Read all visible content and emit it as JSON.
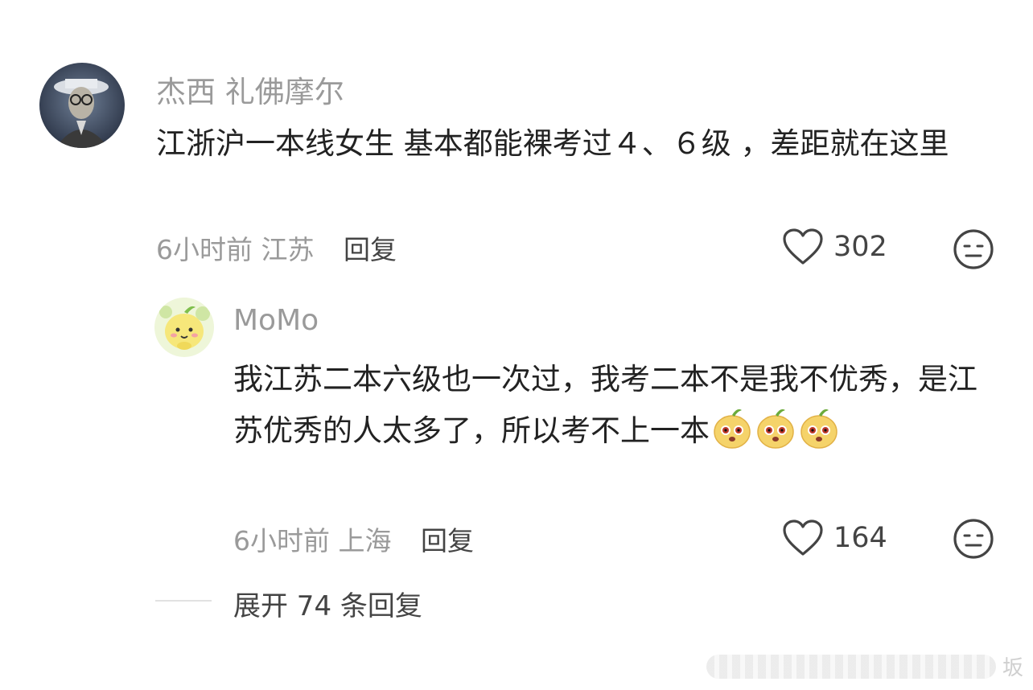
{
  "comment": {
    "username": "杰西 礼佛摩尔",
    "text": "江浙沪一本线女生 基本都能裸考过４、６级 ，差距就在这里",
    "time": "6小时前",
    "location": "江苏",
    "reply_label": "回复",
    "likes": "302",
    "like_icon": "heart-outline-icon",
    "dislike_icon": "meh-face-icon"
  },
  "reply": {
    "username": "MoMo",
    "text": "我江苏二本六级也一次过，我考二本不是我不优秀，是江苏优秀的人太多了，所以考不上一本",
    "emoji_count": 3,
    "emoji_icon": "pear-face-emoji",
    "time": "6小时前",
    "location": "上海",
    "reply_label": "回复",
    "likes": "164",
    "like_icon": "heart-outline-icon",
    "dislike_icon": "meh-face-icon"
  },
  "expand": {
    "label": "展开 74 条回复"
  },
  "watermark": {
    "text": "坂"
  }
}
